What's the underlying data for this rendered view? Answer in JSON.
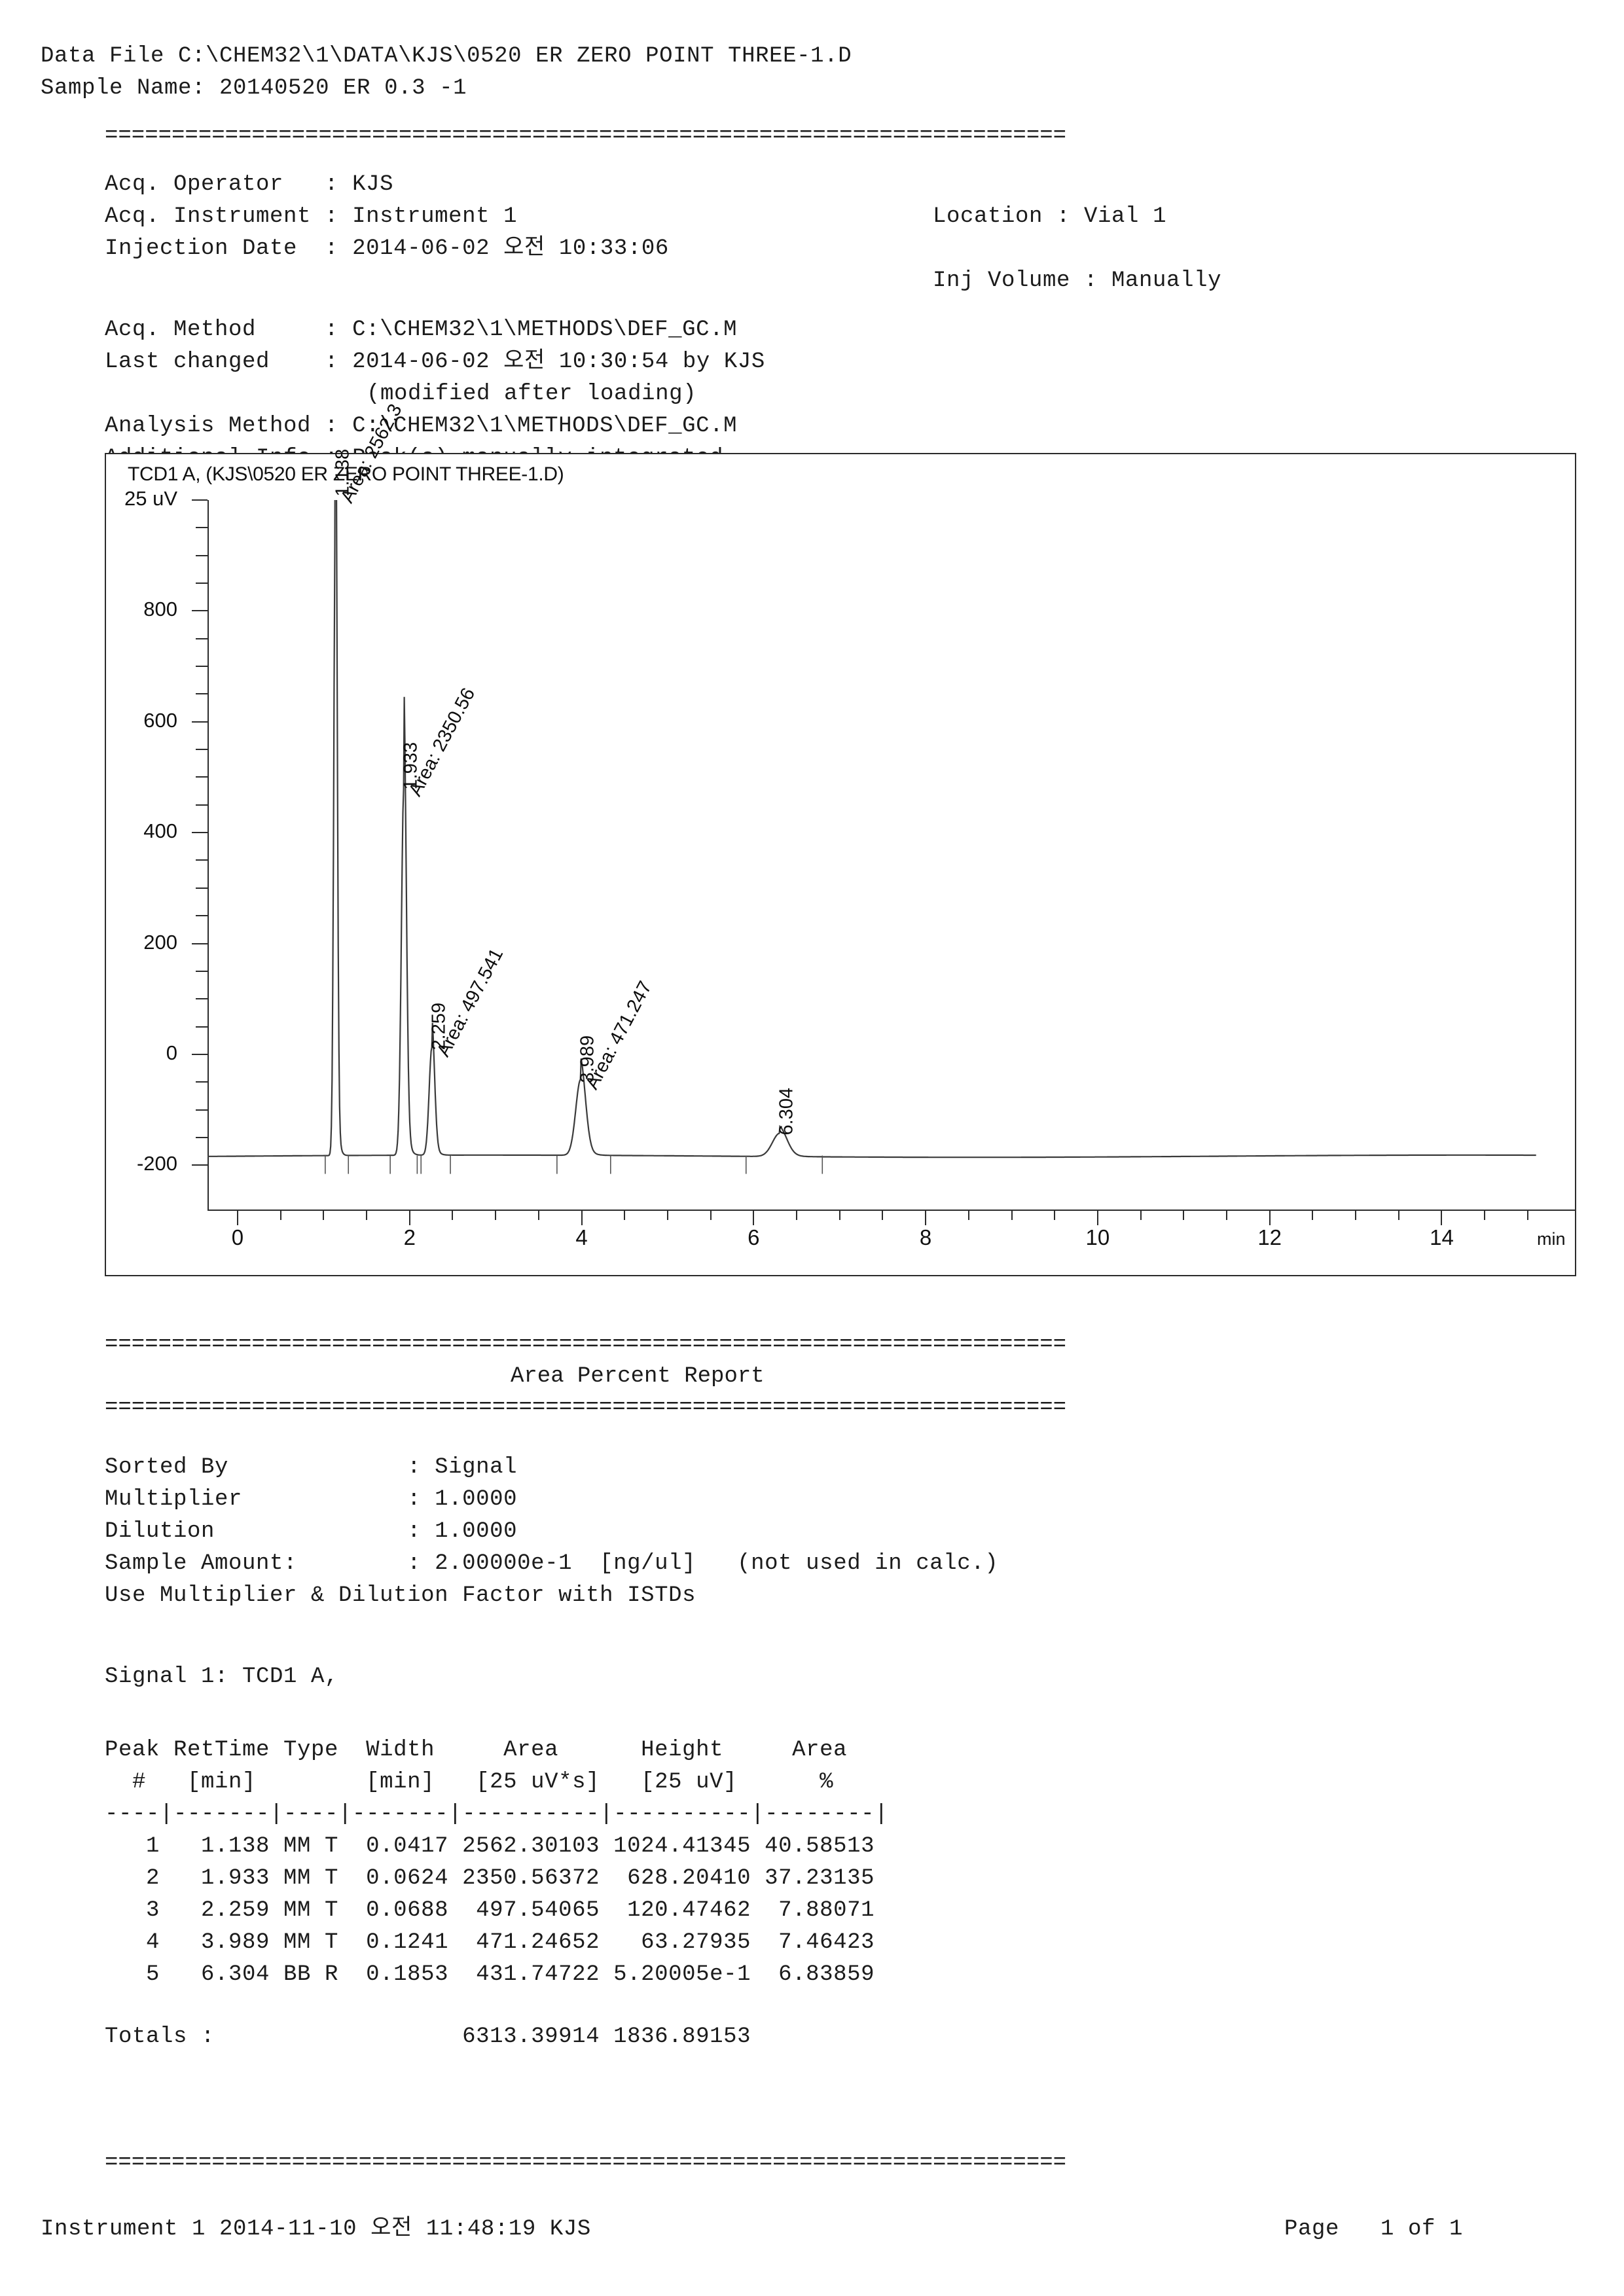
{
  "header": {
    "data_file_line": "Data File C:\\CHEM32\\1\\DATA\\KJS\\0520 ER ZERO POINT THREE-1.D",
    "sample_name_line": "Sample Name: 20140520 ER 0.3 -1",
    "rule": "========================================================================"
  },
  "acq": {
    "operator_label": "Acq. Operator   : ",
    "operator_value": "KJS",
    "instrument_label": "Acq. Instrument : ",
    "instrument_value": "Instrument 1",
    "location_label": "Location : ",
    "location_value": "Vial 1",
    "injection_date_label": "Injection Date  : ",
    "injection_date_value": "2014-06-02 오전 10:33:06",
    "inj_volume_label": "Inj Volume : ",
    "inj_volume_value": "Manually",
    "acq_method_label": "Acq. Method     : ",
    "acq_method_value": "C:\\CHEM32\\1\\METHODS\\DEF_GC.M",
    "last_changed_label": "Last changed    : ",
    "last_changed_value": "2014-06-02 오전 10:30:54 by KJS",
    "modified_note": "(modified after loading)",
    "analysis_method_label": "Analysis Method : ",
    "analysis_method_value": "C:\\CHEM32\\1\\METHODS\\DEF_GC.M",
    "additional_info_label": "Additional Info : ",
    "additional_info_value": "Peak(s) manually integrated"
  },
  "chart_data": {
    "type": "line",
    "title": "TCD1 A,  (KJS\\0520 ER ZERO POINT THREE-1.D)",
    "xlabel": "min",
    "ylabel": "25 uV",
    "ylim": [
      -280,
      1000
    ],
    "xlim": [
      -0.35,
      15.1
    ],
    "grid": false,
    "legend": "none",
    "y_ticks_major": [
      800,
      600,
      400,
      200,
      0,
      -200
    ],
    "y_tick_labels": [
      "800",
      "600",
      "400",
      "200",
      "0",
      "-200"
    ],
    "y_axis_unit_label": "25 uV",
    "y_axis_unit_value": 1000,
    "x_ticks_major": [
      0,
      2,
      4,
      6,
      8,
      10,
      12,
      14
    ],
    "x_tick_labels": [
      "0",
      "2",
      "4",
      "6",
      "8",
      "10",
      "12",
      "14"
    ],
    "baseline": -185,
    "peaks": [
      {
        "rt": 1.138,
        "rt_label": "1.138",
        "area_label": "Area: 2562.3",
        "height": 1024.41345,
        "apex_y": 1010,
        "width": 0.0417
      },
      {
        "rt": 1.933,
        "rt_label": "1.933",
        "area_label": "Area: 2350.56",
        "height": 628.2041,
        "apex_y": 480,
        "width": 0.0624
      },
      {
        "rt": 2.259,
        "rt_label": "2.259",
        "area_label": "Area: 497.541",
        "height": 120.47462,
        "apex_y": 10,
        "width": 0.0688
      },
      {
        "rt": 3.989,
        "rt_label": "3.989",
        "area_label": "Area: 471.247",
        "height": 63.27935,
        "apex_y": -48,
        "width": 0.1241
      },
      {
        "rt": 6.304,
        "rt_label": "6.304",
        "area_label": "",
        "height": 0.520005,
        "apex_y": -143,
        "width": 0.1853
      }
    ]
  },
  "area_percent_report": {
    "rule": "========================================================================",
    "title": "Area Percent Report"
  },
  "params": {
    "sorted_by_label": "Sorted By             : ",
    "sorted_by_value": "Signal",
    "multiplier_label": "Multiplier            : ",
    "multiplier_value": "1.0000",
    "dilution_label": "Dilution              : ",
    "dilution_value": "1.0000",
    "sample_amount_label": "Sample Amount:        : ",
    "sample_amount_value": "2.00000e-1  [ng/ul]   (not used in calc.)",
    "istd_note": "Use Multiplier & Dilution Factor with ISTDs"
  },
  "signal": {
    "line": "Signal 1: TCD1 A,"
  },
  "table": {
    "header_row1": "Peak RetTime Type  Width     Area      Height     Area",
    "header_row2": "  #   [min]        [min]   [25 uV*s]   [25 uV]      %",
    "divider": "----|-------|----|-------|----------|----------|--------|",
    "columns": [
      "Peak #",
      "RetTime [min]",
      "Type",
      "Width [min]",
      "Area [25 uV*s]",
      "Height [25 uV]",
      "Area %"
    ],
    "rows": [
      "   1   1.138 MM T  0.0417 2562.30103 1024.41345 40.58513",
      "   2   1.933 MM T  0.0624 2350.56372  628.20410 37.23135",
      "   3   2.259 MM T  0.0688  497.54065  120.47462  7.88071",
      "   4   3.989 MM T  0.1241  471.24652   63.27935  7.46423",
      "   5   6.304 BB R  0.1853  431.74722 5.20005e-1  6.83859"
    ],
    "rows_data": [
      {
        "peak": "1",
        "rettime": "1.138",
        "type": "MM T",
        "width": "0.0417",
        "area": "2562.30103",
        "height": "1024.41345",
        "area_pct": "40.58513"
      },
      {
        "peak": "2",
        "rettime": "1.933",
        "type": "MM T",
        "width": "0.0624",
        "area": "2350.56372",
        "height": "628.20410",
        "area_pct": "37.23135"
      },
      {
        "peak": "3",
        "rettime": "2.259",
        "type": "MM T",
        "width": "0.0688",
        "area": "497.54065",
        "height": "120.47462",
        "area_pct": "7.88071"
      },
      {
        "peak": "4",
        "rettime": "3.989",
        "type": "MM T",
        "width": "0.1241",
        "area": "471.24652",
        "height": "63.27935",
        "area_pct": "7.46423"
      },
      {
        "peak": "5",
        "rettime": "6.304",
        "type": "BB R",
        "width": "0.1853",
        "area": "431.74722",
        "height": "5.20005e-1",
        "area_pct": "6.83859"
      }
    ],
    "totals_line": "Totals :                  6313.39914 1836.89153",
    "totals_area": "6313.39914",
    "totals_height": "1836.89153"
  },
  "footer": {
    "rule": "========================================================================",
    "left": "Instrument 1 2014-11-10 오전 11:48:19 KJS",
    "page": "Page   1 of 1"
  }
}
